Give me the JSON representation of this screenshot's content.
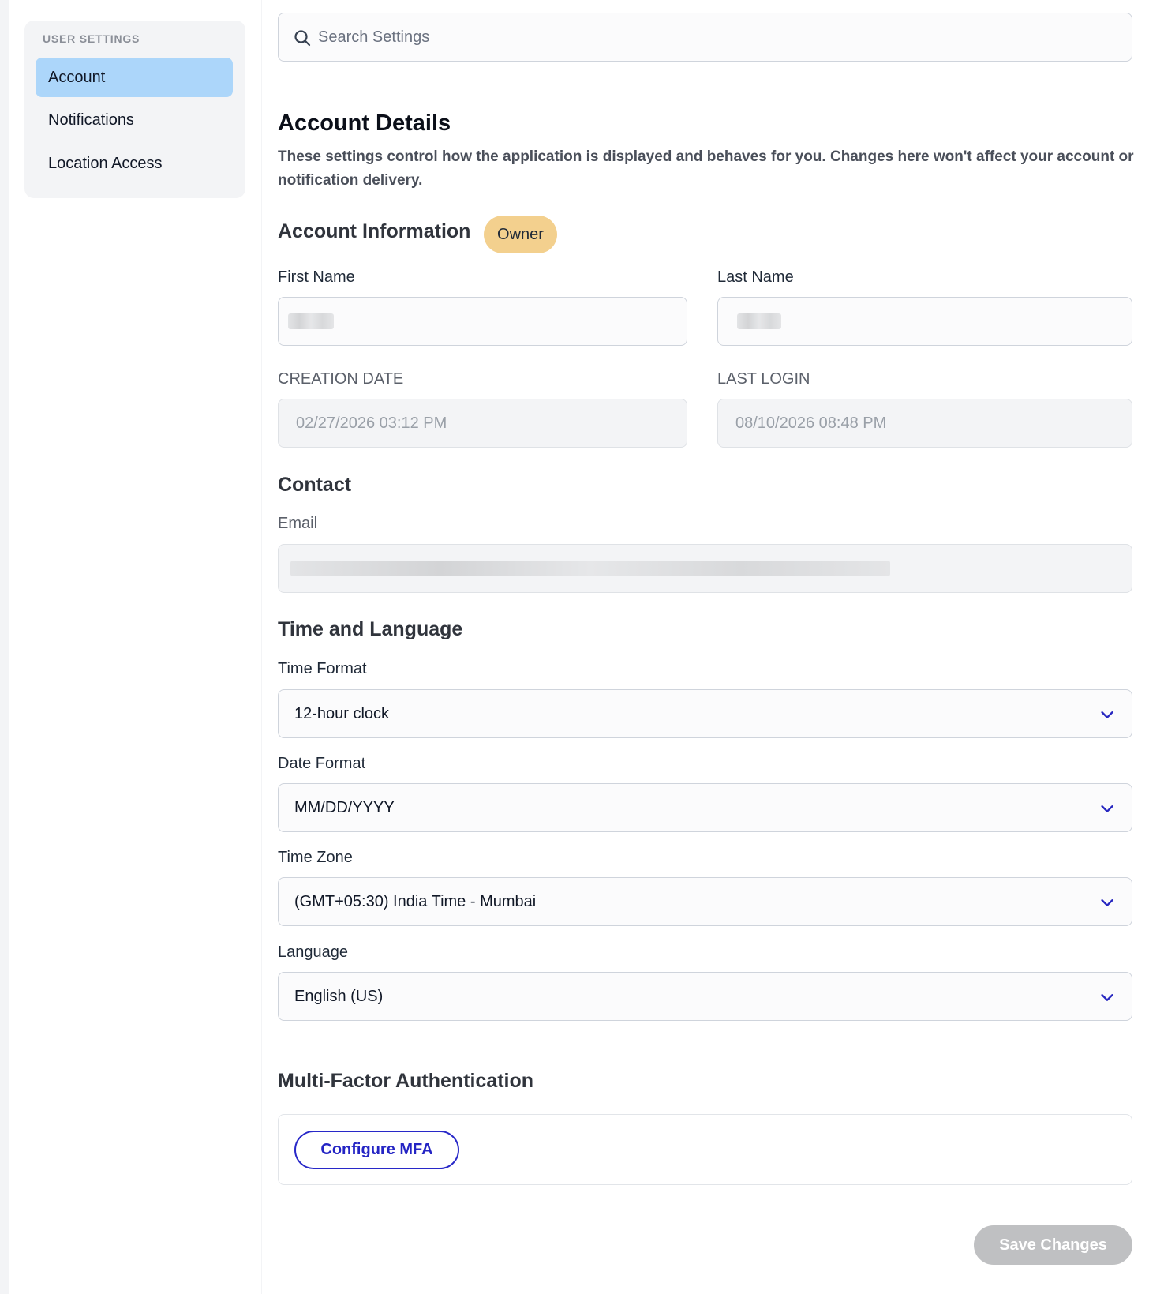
{
  "sidebar": {
    "heading": "USER SETTINGS",
    "items": [
      {
        "label": "Account",
        "active": true
      },
      {
        "label": "Notifications",
        "active": false
      },
      {
        "label": "Location Access",
        "active": false
      }
    ]
  },
  "search": {
    "placeholder": "Search Settings"
  },
  "page": {
    "title": "Account Details",
    "description": "These settings control how the application is displayed and behaves for you. Changes here won't affect your account or notification delivery."
  },
  "account_info": {
    "title": "Account Information",
    "badge": "Owner",
    "first_name_label": "First Name",
    "last_name_label": "Last Name",
    "creation_date_label": "CREATION DATE",
    "creation_date_value": "02/27/2026 03:12 PM",
    "last_login_label": "LAST LOGIN",
    "last_login_value": "08/10/2026 08:48 PM"
  },
  "contact": {
    "title": "Contact",
    "email_label": "Email"
  },
  "time_language": {
    "title": "Time and Language",
    "time_format_label": "Time Format",
    "time_format_value": "12-hour clock",
    "date_format_label": "Date Format",
    "date_format_value": "MM/DD/YYYY",
    "time_zone_label": "Time Zone",
    "time_zone_value": "(GMT+05:30) India Time - Mumbai",
    "language_label": "Language",
    "language_value": "English (US)"
  },
  "mfa": {
    "title": "Multi-Factor Authentication",
    "button_label": "Configure MFA"
  },
  "footer": {
    "save_label": "Save Changes"
  },
  "colors": {
    "active_nav": "#acd6fa",
    "badge": "#f3d08e",
    "accent": "#2424c4",
    "disabled_button": "#bfc0c2"
  }
}
